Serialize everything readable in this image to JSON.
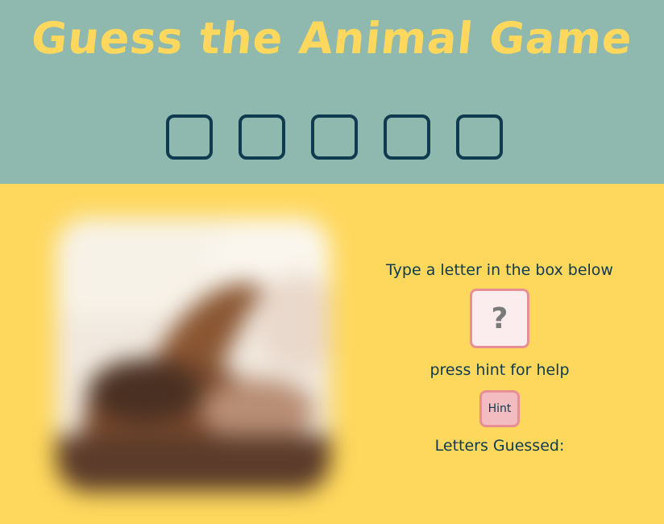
{
  "game": {
    "title": "Guess the Animal Game",
    "slots": [
      "",
      "",
      "",
      "",
      ""
    ]
  },
  "controls": {
    "prompt": "Type a letter in the box below",
    "letter_placeholder": "?",
    "help_text": "press hint for help",
    "hint_label": "Hint",
    "guessed_label": "Letters Guessed:"
  },
  "colors": {
    "header_bg": "#8fb9ae",
    "page_bg": "#fed85d",
    "title": "#fed85d",
    "text": "#0f3a4f",
    "input_border": "#e88f96",
    "input_bg": "#fbeced",
    "hint_bg": "#f3bcc0"
  }
}
